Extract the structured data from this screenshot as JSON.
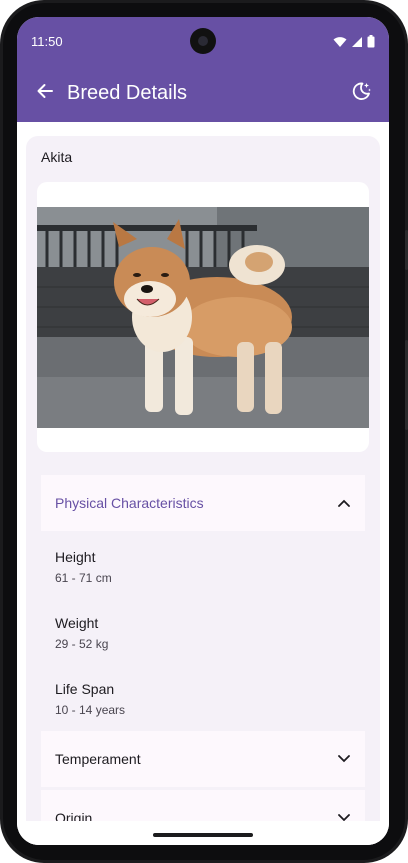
{
  "status_bar": {
    "time": "11:50",
    "icons": [
      "wifi-icon",
      "signal-icon",
      "battery-icon"
    ]
  },
  "app_bar": {
    "title": "Breed Details",
    "back_icon": "arrow-back-icon",
    "theme_icon": "dark-mode-icon",
    "color": "#6750a4"
  },
  "breed": {
    "name": "Akita",
    "photo": "akita-dog-photo"
  },
  "sections": {
    "physical": {
      "title": "Physical Characteristics",
      "expanded": true,
      "attributes": [
        {
          "label": "Height",
          "value": "61 - 71 cm"
        },
        {
          "label": "Weight",
          "value": "29 - 52 kg"
        },
        {
          "label": "Life Span",
          "value": "10 - 14 years"
        }
      ]
    },
    "temperament": {
      "title": "Temperament",
      "expanded": false
    },
    "origin": {
      "title": "Origin",
      "expanded": false
    }
  },
  "colors": {
    "primary": "#6750a4",
    "surface": "#f5f1f8",
    "text": "#1d1b20",
    "secondary_text": "#49454f"
  }
}
